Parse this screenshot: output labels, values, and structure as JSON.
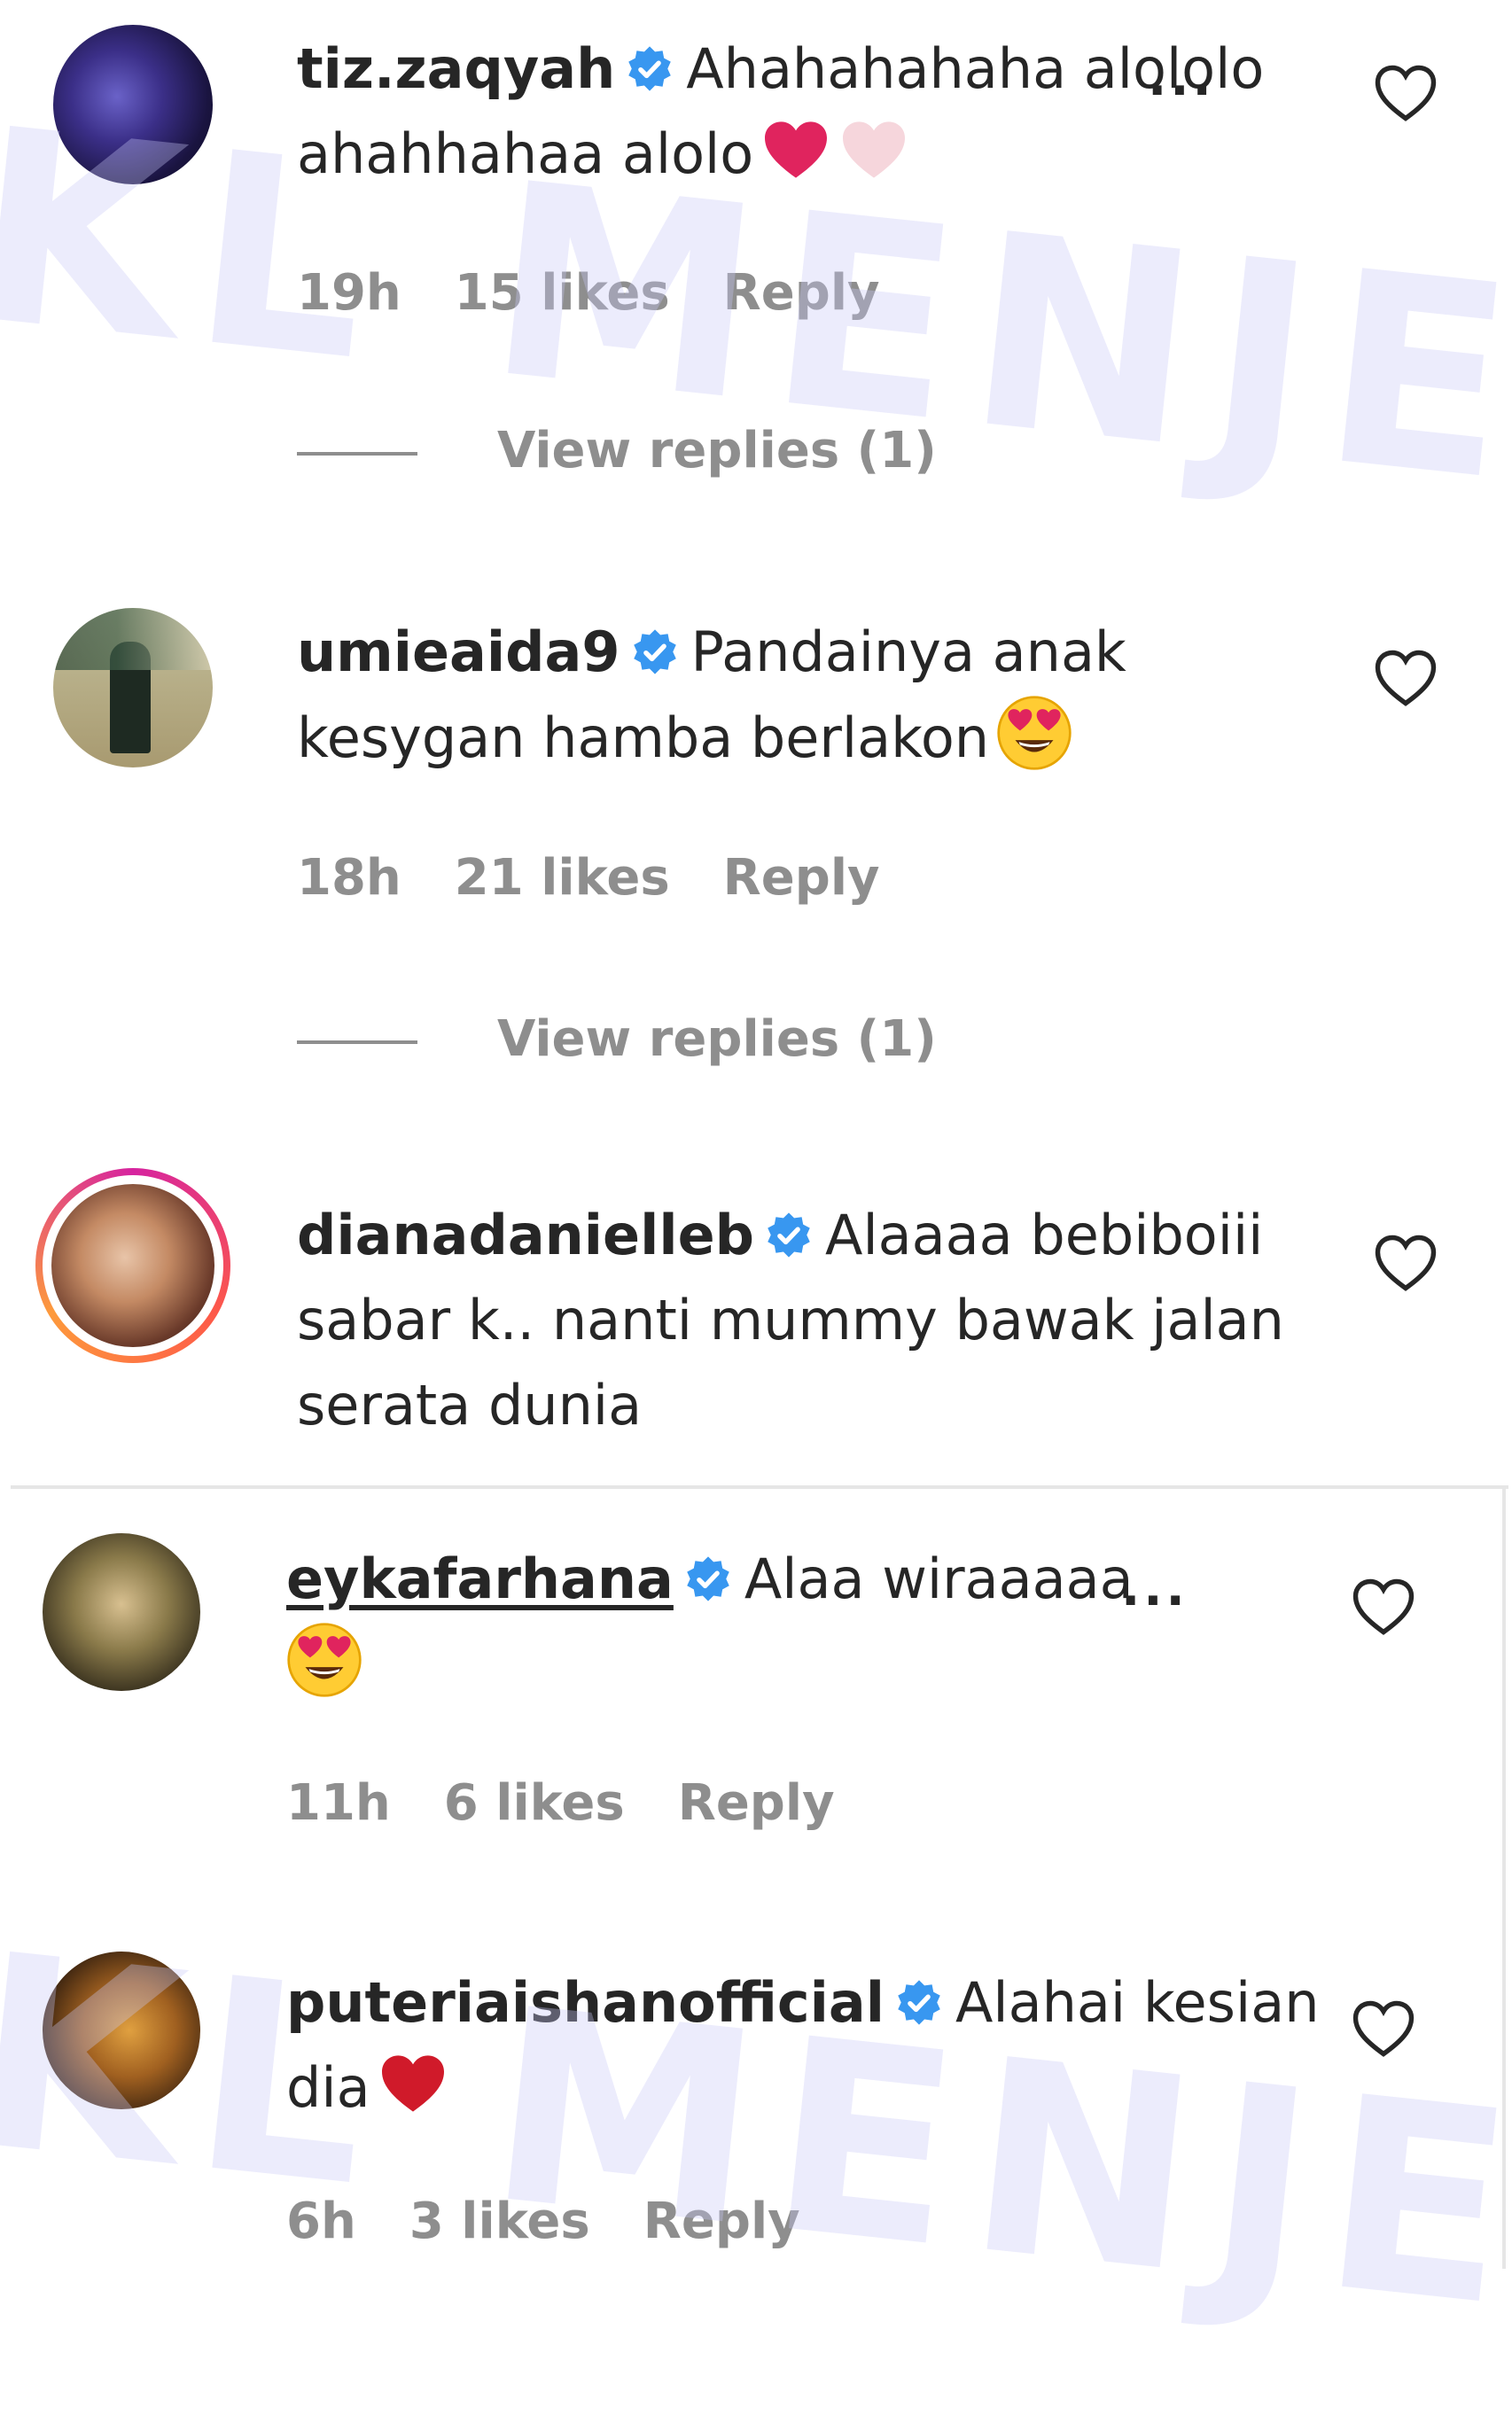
{
  "comments": [
    {
      "username": "tiz.zaqyah",
      "text": "Ahahahahaha alololo ahahhahaa alolo",
      "time": "19h",
      "likes": "15 likes",
      "reply": "Reply",
      "view_replies": "View replies (1)",
      "more": "..."
    },
    {
      "username": "umieaida9",
      "text": "Pandainya anak kesygan hamba berlakon",
      "time": "18h",
      "likes": "21 likes",
      "reply": "Reply",
      "view_replies": "View replies (1)"
    },
    {
      "username": "dianadanielleb",
      "text": "Alaaaa bebiboiii sabar k.. nanti mummy bawak jalan serata dunia"
    },
    {
      "username": "eykafarhana",
      "text": "Alaa wiraaaaa",
      "time": "11h",
      "likes": "6 likes",
      "reply": "Reply",
      "more": "..."
    },
    {
      "username": "puteriaishanofficial",
      "text": "Alahai kesian dia",
      "time": "6h",
      "likes": "3 likes",
      "reply": "Reply"
    }
  ],
  "watermark": "KL MENJERIT",
  "colors": {
    "text": "#262626",
    "meta": "#8e8e8e",
    "verified": "#3897f0",
    "heart_red": "#e0245e"
  }
}
